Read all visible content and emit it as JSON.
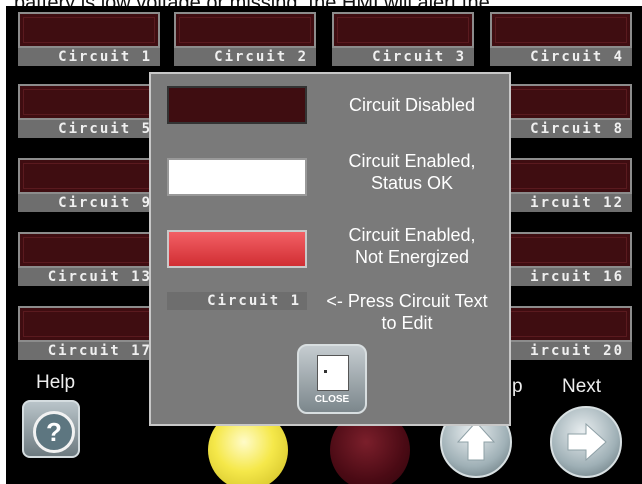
{
  "caption": "battery is low voltage or missing, the HMI will alert the",
  "tiles": {
    "c1": "Circuit 1",
    "c2": "Circuit 2",
    "c3": "Circuit 3",
    "c4": "Circuit 4",
    "c5": "Circuit 5",
    "c8": "Circuit 8",
    "c9": "Circuit 9",
    "c12": "ircuit 12",
    "c13": "Circuit 13",
    "c16": "ircuit 16",
    "c17": "Circuit 17",
    "c20": "ircuit 20"
  },
  "nav": {
    "help_label": "Help",
    "next_label": "Next",
    "up_partial": "p",
    "help_icon": "?"
  },
  "dialog": {
    "disabled_label": "Circuit Disabled",
    "ok_line1": "Circuit Enabled,",
    "ok_line2": "Status OK",
    "notenergized_line1": "Circuit Enabled,",
    "notenergized_line2": "Not Energized",
    "sample_label": "Circuit 1",
    "edit_line1": "<- Press Circuit Text",
    "edit_line2": "to Edit",
    "close_label": "CLOSE"
  },
  "colors": {
    "disabled": "#3f0d11",
    "ok": "#ffffff",
    "not_energized": "#e33b3f",
    "yellow": "#f5e84a",
    "maroon": "#4a0a14"
  }
}
